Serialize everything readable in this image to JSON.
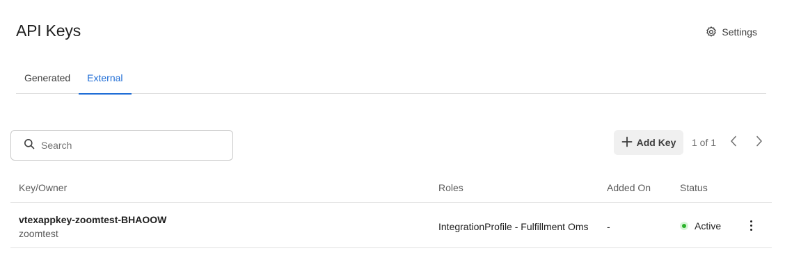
{
  "header": {
    "title": "API Keys",
    "settings_label": "Settings",
    "settings_icon": "gear-icon"
  },
  "tabs": [
    {
      "label": "Generated",
      "active": false
    },
    {
      "label": "External",
      "active": true
    }
  ],
  "toolbar": {
    "search_placeholder": "Search",
    "search_value": "",
    "add_key_label": "Add Key",
    "pagination": "1 of 1"
  },
  "table": {
    "columns": [
      "Key/Owner",
      "Roles",
      "Added On",
      "Status"
    ],
    "rows": [
      {
        "key": "vtexappkey-zoomtest-BHAOOW",
        "owner": "zoomtest",
        "roles": "IntegrationProfile - Fulfillment Oms",
        "added_on": "-",
        "status": "Active"
      }
    ]
  },
  "colors": {
    "accent": "#1f6dd6",
    "status_active": "#2bb32b"
  }
}
